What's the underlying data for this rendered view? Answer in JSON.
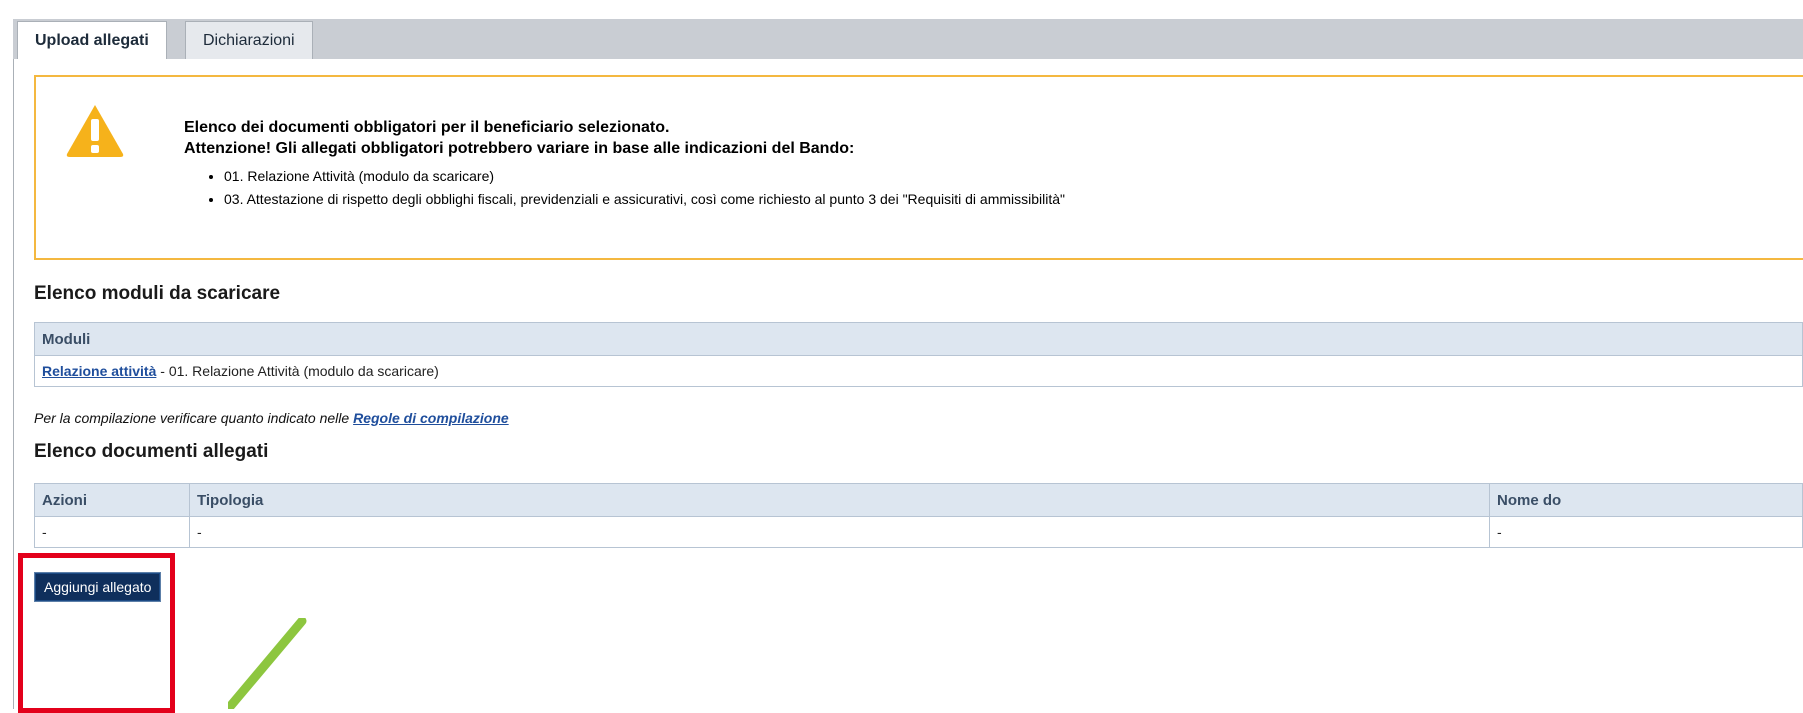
{
  "tabs": [
    {
      "label": "Upload allegati",
      "active": true
    },
    {
      "label": "Dichiarazioni",
      "active": false
    }
  ],
  "warning": {
    "icon": "warning-triangle-icon",
    "title_line1": "Elenco dei documenti obbligatori per il beneficiario selezionato.",
    "title_line2": "Attenzione! Gli allegati obbligatori potrebbero variare in base alle indicazioni del Bando:",
    "items": [
      "01. Relazione Attività (modulo da scaricare)",
      "03. Attestazione di rispetto degli obblighi fiscali, previdenziali e assicurativi, così come richiesto al punto 3 dei \"Requisiti di ammissibilità\""
    ]
  },
  "modules": {
    "heading": "Elenco moduli da scaricare",
    "column": "Moduli",
    "rows": [
      {
        "link": "Relazione attività",
        "text": " - 01. Relazione Attività (modulo da scaricare)"
      }
    ]
  },
  "note": {
    "text": "Per la compilazione verificare quanto indicato nelle ",
    "link": "Regole di compilazione"
  },
  "attachments": {
    "heading": "Elenco documenti allegati",
    "columns": [
      "Azioni",
      "Tipologia",
      "Nome do"
    ],
    "rows": [
      [
        "-",
        "-",
        "-"
      ]
    ]
  },
  "add_button_label": "Aggiungi allegato",
  "colors": {
    "highlight": "#e3001b",
    "arrow": "#8dc63f",
    "warning_border": "#f4b840",
    "button_bg": "#0f2f5c"
  }
}
